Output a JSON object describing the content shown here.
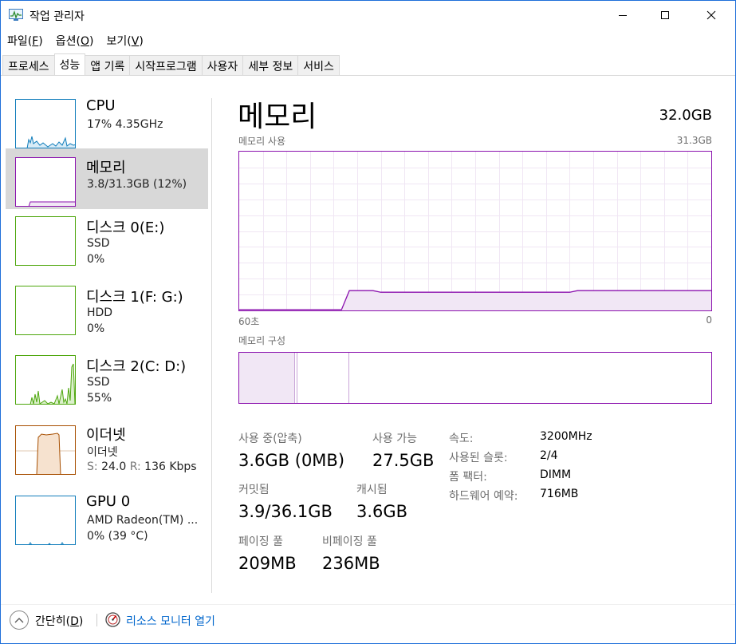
{
  "window": {
    "title": "작업 관리자",
    "controls": {
      "minimize": "–",
      "maximize": "☐",
      "close": "✕"
    }
  },
  "menu": [
    {
      "label": "파일(",
      "accel": "F",
      "end": ")"
    },
    {
      "label": "옵션(",
      "accel": "O",
      "end": ")"
    },
    {
      "label": "보기(",
      "accel": "V",
      "end": ")"
    }
  ],
  "tabs": [
    "프로세스",
    "성능",
    "앱 기록",
    "시작프로그램",
    "사용자",
    "세부 정보",
    "서비스"
  ],
  "active_tab": "성능",
  "sidebar": [
    {
      "name": "CPU",
      "sub1": "17% 4.35GHz",
      "sub2": "",
      "color": "#117dbb",
      "active": false
    },
    {
      "name": "메모리",
      "sub1": "3.8/31.3GB (12%)",
      "sub2": "",
      "color": "#8b12ae",
      "active": true
    },
    {
      "name": "디스크 0(E:)",
      "sub1": "SSD",
      "sub2": "0%",
      "color": "#4da60c",
      "active": false
    },
    {
      "name": "디스크 1(F: G:)",
      "sub1": "HDD",
      "sub2": "0%",
      "color": "#4da60c",
      "active": false
    },
    {
      "name": "디스크 2(C: D:)",
      "sub1": "SSD",
      "sub2": "55%",
      "color": "#4da60c",
      "active": false
    },
    {
      "name": "이더넷",
      "sub1": "이더넷",
      "sub2_parts": {
        "s_label": "S:",
        "s_value": "24.0",
        "r_label": "R:",
        "r_value": "136 Kbps"
      },
      "color": "#a74f01",
      "active": false
    },
    {
      "name": "GPU 0",
      "sub1": "AMD Radeon(TM) ...",
      "sub2": "0% (39 °C)",
      "color": "#117dbb",
      "active": false
    }
  ],
  "main": {
    "title": "메모리",
    "total": "32.0GB",
    "usage_label": "메모리 사용",
    "usage_max": "31.3GB",
    "axis_left": "60초",
    "axis_right": "0",
    "composition_label": "메모리 구성",
    "usage_series": [
      0,
      0,
      0,
      0,
      0,
      0,
      0,
      0,
      0,
      0,
      0,
      0,
      0,
      0,
      12,
      12,
      12,
      12,
      11,
      11,
      11,
      11,
      11,
      11,
      11,
      11,
      11,
      11,
      11,
      11,
      11,
      11,
      11,
      11,
      11,
      11,
      11,
      11,
      11,
      11,
      11,
      11,
      11,
      12,
      12,
      12,
      12,
      12,
      12,
      12,
      12,
      12,
      12,
      12,
      12,
      12,
      12,
      12,
      12,
      12,
      12
    ],
    "stats": {
      "in_use_label": "사용 중(압축)",
      "in_use_value": "3.6GB (0MB)",
      "available_label": "사용 가능",
      "available_value": "27.5GB",
      "committed_label": "커밋됨",
      "committed_value": "3.9/36.1GB",
      "cached_label": "캐시됨",
      "cached_value": "3.6GB",
      "paged_label": "페이징 풀",
      "paged_value": "209MB",
      "nonpaged_label": "비페이징 풀",
      "nonpaged_value": "236MB"
    },
    "specs": [
      {
        "label": "속도:",
        "value": "3200MHz"
      },
      {
        "label": "사용된 슬롯:",
        "value": "2/4"
      },
      {
        "label": "폼 팩터:",
        "value": "DIMM"
      },
      {
        "label": "하드웨어 예약:",
        "value": "716MB"
      }
    ]
  },
  "footer": {
    "fewer_details": "간단히(",
    "fewer_accel": "D",
    "fewer_end": ")",
    "resource_monitor": "리소스 모니터 열기"
  },
  "colors": {
    "memory": "#8b12ae",
    "cpu": "#117dbb",
    "disk": "#4da60c",
    "ethernet": "#a74f01",
    "link": "#0066cc"
  }
}
